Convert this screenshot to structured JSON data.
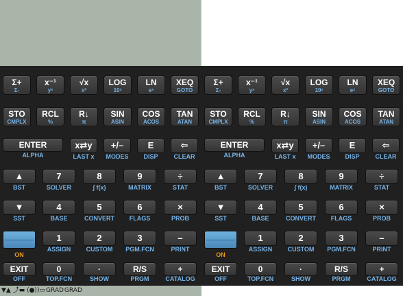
{
  "annunciators": {
    "glyphs": "▼▲ ⤴▬ (●))▭",
    "grad1": "GRAD",
    "grad2": "GRAD"
  },
  "rows": [
    [
      {
        "main": "Σ+",
        "in": "Σ-",
        "kind": "top"
      },
      {
        "main": "x⁻¹",
        "in": "yˣ",
        "kind": "top"
      },
      {
        "main": "√x",
        "in": "x²",
        "kind": "top"
      },
      {
        "main": "LOG",
        "in": "10ˣ",
        "kind": "top"
      },
      {
        "main": "LN",
        "in": "eˣ",
        "kind": "top"
      },
      {
        "main": "XEQ",
        "in": "GOTO",
        "kind": "top"
      }
    ],
    [
      {
        "main": "STO",
        "in": "CMPLX",
        "kind": "top"
      },
      {
        "main": "RCL",
        "in": "%",
        "kind": "top"
      },
      {
        "main": "R↓",
        "in": "π",
        "kind": "top"
      },
      {
        "main": "SIN",
        "in": "ASIN",
        "kind": "top"
      },
      {
        "main": "COS",
        "in": "ACOS",
        "kind": "top"
      },
      {
        "main": "TAN",
        "in": "ATAN",
        "kind": "top"
      }
    ],
    [
      {
        "main": "ENTER",
        "lbl": "ALPHA",
        "kind": "enter"
      },
      {
        "main": "x⇄y",
        "lbl": "LAST x",
        "kind": "sk"
      },
      {
        "main": "+/–",
        "lbl": "MODES",
        "kind": "sk"
      },
      {
        "main": "E",
        "lbl": "DISP",
        "kind": "sk"
      },
      {
        "main": "⇦",
        "lbl": "CLEAR",
        "kind": "sk"
      }
    ],
    [
      {
        "main": "▲",
        "lbl": "BST",
        "kind": "std"
      },
      {
        "main": "7",
        "lbl": "SOLVER",
        "kind": "std"
      },
      {
        "main": "8",
        "lbl": "∫ f(x)",
        "kind": "std"
      },
      {
        "main": "9",
        "lbl": "MATRIX",
        "kind": "std"
      },
      {
        "main": "÷",
        "lbl": "STAT",
        "kind": "std"
      }
    ],
    [
      {
        "main": "▼",
        "lbl": "SST",
        "kind": "std"
      },
      {
        "main": "4",
        "lbl": "BASE",
        "kind": "std"
      },
      {
        "main": "5",
        "lbl": "CONVERT",
        "kind": "std"
      },
      {
        "main": "6",
        "lbl": "FLAGS",
        "kind": "std"
      },
      {
        "main": "×",
        "lbl": "PROB",
        "kind": "std"
      }
    ],
    [
      {
        "main": "",
        "lbl": "ON",
        "kind": "shift"
      },
      {
        "main": "1",
        "lbl": "ASSIGN",
        "kind": "std"
      },
      {
        "main": "2",
        "lbl": "CUSTOM",
        "kind": "std"
      },
      {
        "main": "3",
        "lbl": "PGM.FCN",
        "kind": "std"
      },
      {
        "main": "–",
        "lbl": "PRINT",
        "kind": "std"
      }
    ],
    [
      {
        "main": "EXIT",
        "lbl": "OFF",
        "kind": "bot"
      },
      {
        "main": "0",
        "lbl": "TOP.FCN",
        "kind": "bot"
      },
      {
        "main": "·",
        "lbl": "SHOW",
        "kind": "bot"
      },
      {
        "main": "R/S",
        "lbl": "PRGM",
        "kind": "bot"
      },
      {
        "main": "+",
        "lbl": "CATALOG",
        "kind": "bot"
      }
    ]
  ]
}
